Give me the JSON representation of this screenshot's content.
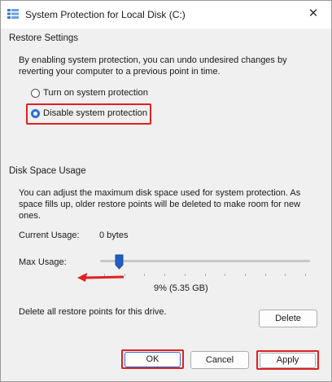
{
  "window": {
    "title": "System Protection for Local Disk (C:)",
    "close_glyph": "✕",
    "app_icon": "system-protection-icon"
  },
  "restore_settings": {
    "heading": "Restore Settings",
    "description_line1": "By enabling system protection, you can undo undesired changes by",
    "description_line2": "reverting your computer to a previous point in time.",
    "options": [
      {
        "label": "Turn on system protection",
        "checked": false
      },
      {
        "label": "Disable system protection",
        "checked": true
      }
    ]
  },
  "disk_space": {
    "heading": "Disk Space Usage",
    "description_line1": "You can adjust the maximum disk space used for system protection. As",
    "description_line2": "space fills up, older restore points will be deleted to make room for new",
    "description_line3": "ones.",
    "current_usage_label": "Current Usage:",
    "current_usage_value": "0 bytes",
    "max_usage_label": "Max Usage:",
    "max_usage_percent": 9,
    "max_usage_value": "9% (5.35 GB)",
    "delete_description": "Delete all restore points for this drive.",
    "delete_button": "Delete"
  },
  "footer": {
    "ok": "OK",
    "cancel": "Cancel",
    "apply": "Apply"
  },
  "colors": {
    "highlight": "#e02020",
    "accent": "#2a6fd6"
  }
}
